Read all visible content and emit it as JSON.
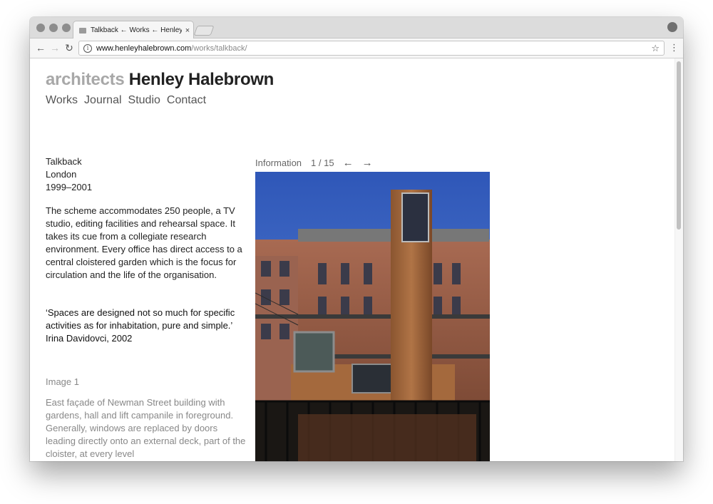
{
  "browser": {
    "tab_title": "Talkback ← Works ← Henley Halebrown",
    "tab_close": "×",
    "url_host": "www.henleyhalebrown.com",
    "url_path": "/works/talkback/"
  },
  "site": {
    "brand_light": "architects",
    "brand_dark": "Henley Halebrown",
    "nav": [
      "Works",
      "Journal",
      "Studio",
      "Contact"
    ]
  },
  "project": {
    "name": "Talkback",
    "location": "London",
    "years": "1999–2001",
    "description": "The scheme accommodates 250 people, a TV studio, editing facilities and rehearsal space. It takes its cue from a collegiate research environment. Every office has direct access to a central cloistered garden which is the focus for circulation and the life of the organisation.",
    "quote": "‘Spaces are designed not so much for specific activities as for inhabitation, pure and simple.’ Irina Davidovci, 2002"
  },
  "gallery": {
    "info_label": "Information",
    "counter": "1 / 15",
    "prev": "←",
    "next": "→",
    "image_label": "Image 1",
    "caption": "East façade of Newman Street building with gardens, hall and lift campanile in foreground. Generally, windows are replaced by doors leading directly onto an external deck, part of the cloister, at every level"
  },
  "icons": {
    "back": "back-arrow-icon",
    "forward": "forward-arrow-icon",
    "reload": "reload-icon",
    "info": "info-icon",
    "star": "bookmark-star-icon",
    "menu": "menu-dots-icon",
    "profile": "profile-icon"
  }
}
